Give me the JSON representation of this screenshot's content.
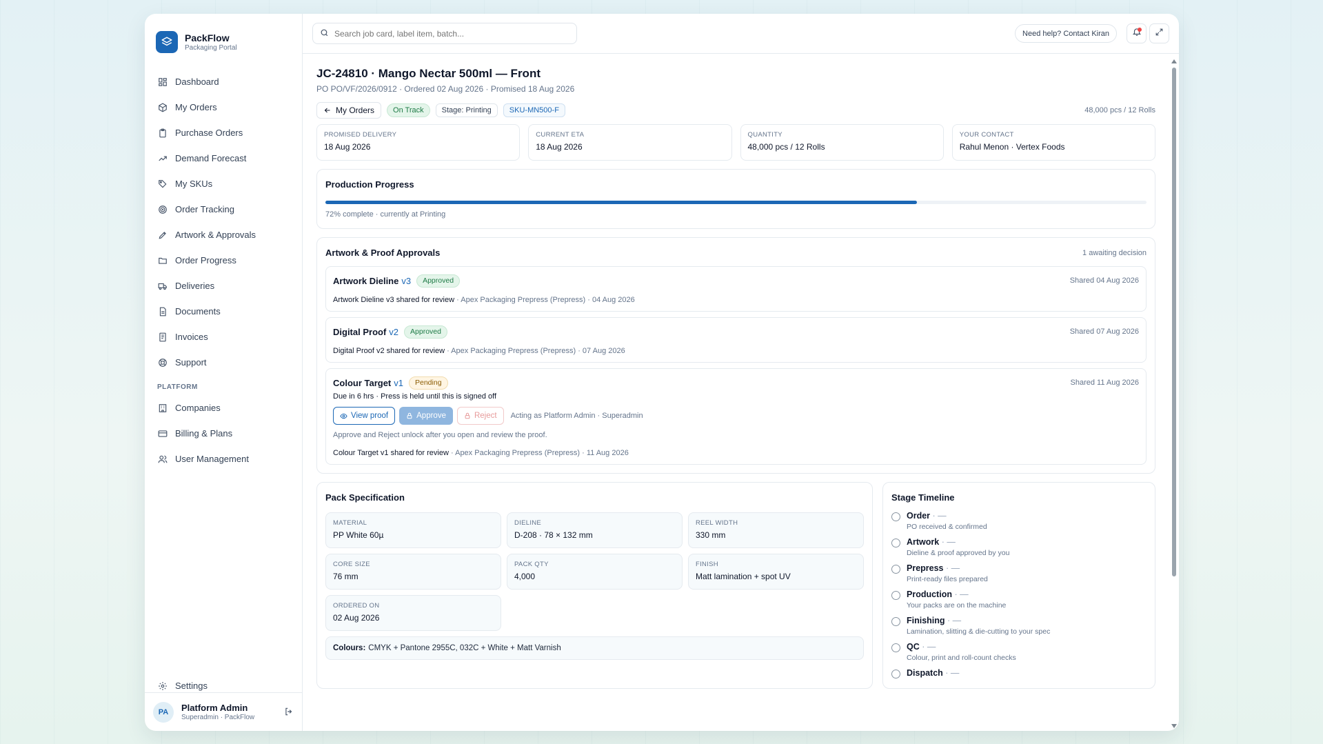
{
  "brand": {
    "name": "PackFlow",
    "sub": "Packaging Portal"
  },
  "nav": {
    "items": [
      {
        "label": "Dashboard",
        "icon": "grid-icon"
      },
      {
        "label": "My Orders",
        "icon": "package-icon"
      },
      {
        "label": "Purchase Orders",
        "icon": "clipboard-icon"
      },
      {
        "label": "Demand Forecast",
        "icon": "trend-icon"
      },
      {
        "label": "My SKUs",
        "icon": "tag-icon"
      },
      {
        "label": "Order Tracking",
        "icon": "target-icon"
      },
      {
        "label": "Artwork & Approvals",
        "icon": "pen-icon"
      },
      {
        "label": "Order Progress",
        "icon": "folder-icon"
      },
      {
        "label": "Deliveries",
        "icon": "truck-icon"
      },
      {
        "label": "Documents",
        "icon": "document-icon"
      },
      {
        "label": "Invoices",
        "icon": "receipt-icon"
      },
      {
        "label": "Support",
        "icon": "lifebuoy-icon"
      }
    ],
    "section": "PLATFORM",
    "platform": [
      {
        "label": "Companies",
        "icon": "building-icon"
      },
      {
        "label": "Billing & Plans",
        "icon": "card-icon"
      },
      {
        "label": "User Management",
        "icon": "users-icon"
      }
    ],
    "settings": "Settings"
  },
  "user": {
    "initials": "PA",
    "name": "Platform Admin",
    "role": "Superadmin · PackFlow"
  },
  "topbar": {
    "search_placeholder": "Search job card, label item, batch...",
    "help": "Need help? Contact Kiran"
  },
  "job": {
    "title": "JC-24810 · Mango Nectar 500ml — Front",
    "subtitle": "PO PO/VF/2026/0912 · Ordered 02 Aug 2026 · Promised 18 Aug 2026",
    "back": "My Orders",
    "status": "On Track",
    "stage": "Stage: Printing",
    "sku": "SKU-MN500-F",
    "qty_summary": "48,000 pcs / 12 Rolls"
  },
  "stats": [
    {
      "label": "Promised Delivery",
      "value": "18 Aug 2026"
    },
    {
      "label": "Current ETA",
      "value": "18 Aug 2026"
    },
    {
      "label": "Quantity",
      "value": "48,000 pcs / 12 Rolls"
    },
    {
      "label": "Your Contact",
      "value": "Rahul Menon · Vertex Foods"
    }
  ],
  "progress": {
    "title": "Production Progress",
    "percent": 72,
    "note": "72% complete · currently at Printing"
  },
  "approvals": {
    "title": "Artwork & Proof Approvals",
    "summary": "1 awaiting decision",
    "items": [
      {
        "name": "Artwork Dieline",
        "version": "v3",
        "status": "Approved",
        "shared": "Shared 04 Aug 2026",
        "line_main": "Artwork Dieline v3 shared for review",
        "line_meta": " · Apex Packaging Prepress (Prepress) · 04 Aug 2026"
      },
      {
        "name": "Digital Proof",
        "version": "v2",
        "status": "Approved",
        "shared": "Shared 07 Aug 2026",
        "line_main": "Digital Proof v2 shared for review",
        "line_meta": " · Apex Packaging Prepress (Prepress) · 07 Aug 2026"
      },
      {
        "name": "Colour Target",
        "version": "v1",
        "status": "Pending",
        "shared": "Shared 11 Aug 2026",
        "due": "Due in 6 hrs · Press is held until this is signed off",
        "view": "View proof",
        "approve": "Approve",
        "reject": "Reject",
        "acting": "Acting as Platform Admin · Superadmin",
        "hint": "Approve and Reject unlock after you open and review the proof.",
        "line_main": "Colour Target v1 shared for review",
        "line_meta": " · Apex Packaging Prepress (Prepress) · 11 Aug 2026"
      }
    ]
  },
  "spec": {
    "title": "Pack Specification",
    "items": [
      {
        "label": "Material",
        "value": "PP White 60µ"
      },
      {
        "label": "Dieline",
        "value": "D-208 · 78 × 132 mm"
      },
      {
        "label": "Reel Width",
        "value": "330 mm"
      },
      {
        "label": "Core Size",
        "value": "76 mm"
      },
      {
        "label": "Pack Qty",
        "value": "4,000"
      },
      {
        "label": "Finish",
        "value": "Matt lamination + spot UV"
      },
      {
        "label": "Ordered On",
        "value": "02 Aug 2026"
      }
    ],
    "colours_label": "Colours:",
    "colours_value": "CMYK + Pantone 2955C, 032C + White + Matt Varnish"
  },
  "timeline": {
    "title": "Stage Timeline",
    "items": [
      {
        "name": "Order",
        "desc": "PO received & confirmed"
      },
      {
        "name": "Artwork",
        "desc": "Dieline & proof approved by you"
      },
      {
        "name": "Prepress",
        "desc": "Print-ready files prepared"
      },
      {
        "name": "Production",
        "desc": "Your packs are on the machine"
      },
      {
        "name": "Finishing",
        "desc": "Lamination, slitting & die-cutting to your spec"
      },
      {
        "name": "QC",
        "desc": "Colour, print and roll-count checks"
      },
      {
        "name": "Dispatch",
        "desc": ""
      }
    ],
    "dash": " · —"
  }
}
